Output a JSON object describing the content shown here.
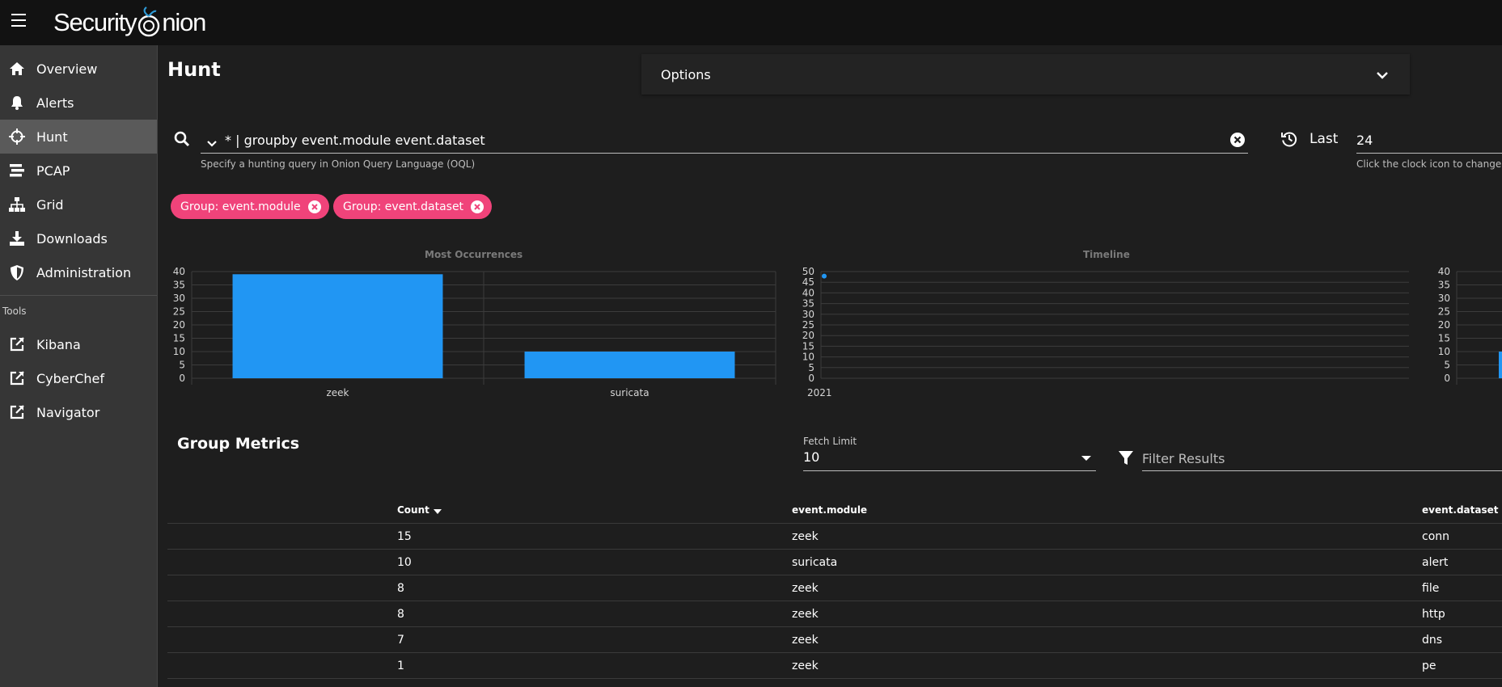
{
  "app": {
    "title_part1": "Security",
    "title_part2": "nion"
  },
  "sidebar": {
    "items": [
      {
        "label": "Overview",
        "icon": "home-icon"
      },
      {
        "label": "Alerts",
        "icon": "bell-icon"
      },
      {
        "label": "Hunt",
        "icon": "crosshairs-icon",
        "active": true
      },
      {
        "label": "PCAP",
        "icon": "stream-icon"
      },
      {
        "label": "Grid",
        "icon": "sitemap-icon"
      },
      {
        "label": "Downloads",
        "icon": "download-icon"
      },
      {
        "label": "Administration",
        "icon": "shield-icon"
      }
    ],
    "tools_label": "Tools",
    "tools": [
      {
        "label": "Kibana",
        "icon": "external-link-icon"
      },
      {
        "label": "CyberChef",
        "icon": "external-link-icon"
      },
      {
        "label": "Navigator",
        "icon": "external-link-icon"
      }
    ]
  },
  "page": {
    "title": "Hunt",
    "options_label": "Options"
  },
  "query": {
    "value": "* | groupby event.module event.dataset",
    "hint": "Specify a hunting query in Onion Query Language (OQL)"
  },
  "date_range": {
    "label": "Last",
    "value": "24",
    "hint": "Click the clock icon to change"
  },
  "chips": [
    {
      "label": "Group: event.module"
    },
    {
      "label": "Group: event.dataset"
    }
  ],
  "colors": {
    "accent_bar": "#2196f3",
    "chip": "#f0437a",
    "background": "#1e1e1e",
    "sidebar": "#363636"
  },
  "chart_data": [
    {
      "type": "bar",
      "title": "Most Occurrences",
      "categories": [
        "zeek",
        "suricata"
      ],
      "values": [
        39,
        10
      ],
      "ylim": [
        0,
        40
      ],
      "yticks": [
        0,
        5,
        10,
        15,
        20,
        25,
        30,
        35,
        40
      ],
      "grid": true
    },
    {
      "type": "scatter",
      "title": "Timeline",
      "x": [
        "2021"
      ],
      "values": [
        49
      ],
      "ylim": [
        0,
        50
      ],
      "yticks": [
        0,
        5,
        10,
        15,
        20,
        25,
        30,
        35,
        40,
        45,
        50
      ],
      "xtick_labels": [
        "2021"
      ],
      "grid": true
    },
    {
      "type": "bar",
      "title": "",
      "categories": [
        ""
      ],
      "values": [
        10
      ],
      "ylim": [
        0,
        40
      ],
      "yticks": [
        0,
        5,
        10,
        15,
        20,
        25,
        30,
        35,
        40
      ],
      "grid": true
    }
  ],
  "group_metrics": {
    "title": "Group Metrics",
    "fetch_limit_label": "Fetch Limit",
    "fetch_limit_value": "10",
    "filter_placeholder": "Filter Results",
    "columns": [
      "Count",
      "event.module",
      "event.dataset"
    ],
    "rows": [
      {
        "count": "15",
        "module": "zeek",
        "dataset": "conn"
      },
      {
        "count": "10",
        "module": "suricata",
        "dataset": "alert"
      },
      {
        "count": "8",
        "module": "zeek",
        "dataset": "file"
      },
      {
        "count": "8",
        "module": "zeek",
        "dataset": "http"
      },
      {
        "count": "7",
        "module": "zeek",
        "dataset": "dns"
      },
      {
        "count": "1",
        "module": "zeek",
        "dataset": "pe"
      }
    ]
  }
}
